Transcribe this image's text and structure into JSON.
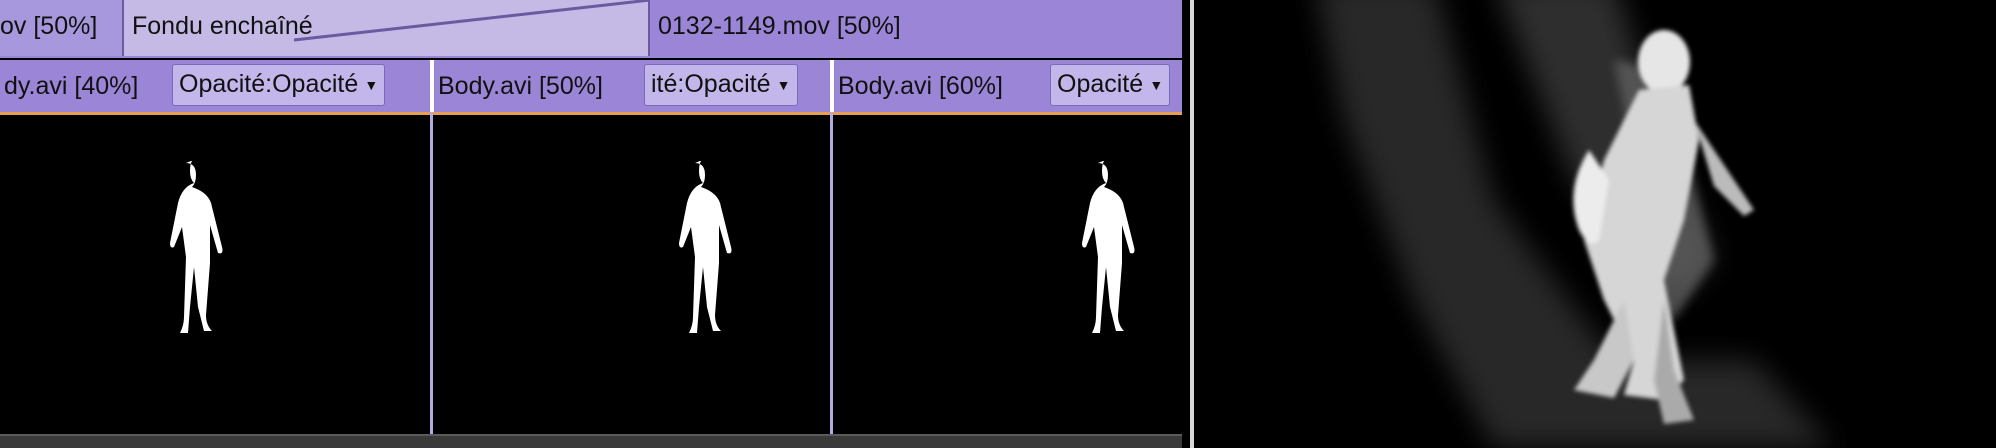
{
  "clips_top": [
    {
      "label": "ov [50%]"
    },
    {
      "label": "Fondu enchaîné"
    },
    {
      "label": "0132-1149.mov [50%]"
    }
  ],
  "tracks": [
    {
      "file": "dy.avi [40%]",
      "param": "Opacité:Opacité"
    },
    {
      "file": "Body.avi [50%]",
      "param": "ité:Opacité"
    },
    {
      "file": "Body.avi [60%]",
      "param": "Opacité"
    }
  ],
  "colors": {
    "clip_purple": "#9b85d6",
    "transition_lavender": "#c5b9e6",
    "track_rule_orange": "#e8a050"
  },
  "icons": {
    "param_dropdown": "chevron-down-icon"
  }
}
